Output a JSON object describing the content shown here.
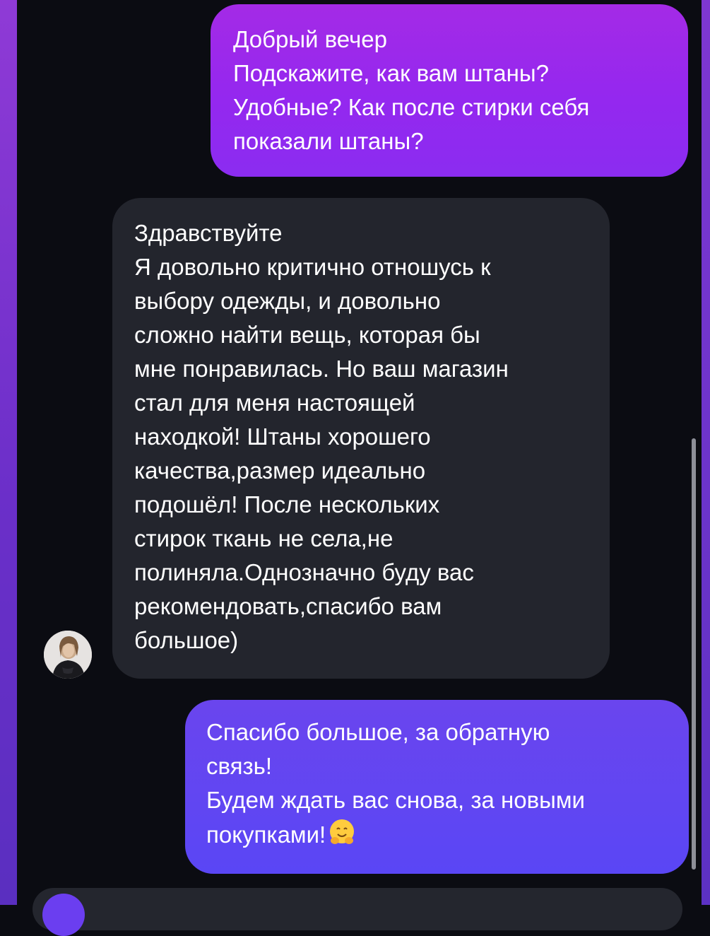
{
  "messages": {
    "outgoing_1": {
      "lines": [
        "Добрый вечер",
        "Подскажите, как вам штаны?",
        "Удобные? Как после стирки себя",
        "показали штаны?"
      ]
    },
    "incoming_1": {
      "lines": [
        "Здравствуйте",
        "Я довольно критично отношусь к",
        "выбору одежды, и довольно",
        "сложно найти вещь, которая бы",
        "мне понравилась. Но ваш магазин",
        "стал для меня настоящей",
        "находкой! Штаны хорошего",
        "качества,размер идеально",
        "подошёл! После нескольких",
        "стирок ткань не села,не",
        "полиняла.Однозначно буду вас",
        "рекомендовать,спасибо вам",
        "большое)"
      ]
    },
    "outgoing_2": {
      "lines": [
        "Спасибо большое, за обратную",
        "связь!",
        "Будем ждать вас снова, за новыми",
        "покупками!"
      ],
      "emoji": "hugging-face-icon"
    }
  },
  "colors": {
    "background": "#0b0c12",
    "outgoing_bubble_top": "#a42ae6",
    "outgoing_bubble_bottom": "#5a46f5",
    "incoming_bubble": "#23252d",
    "text": "#ffffff"
  }
}
